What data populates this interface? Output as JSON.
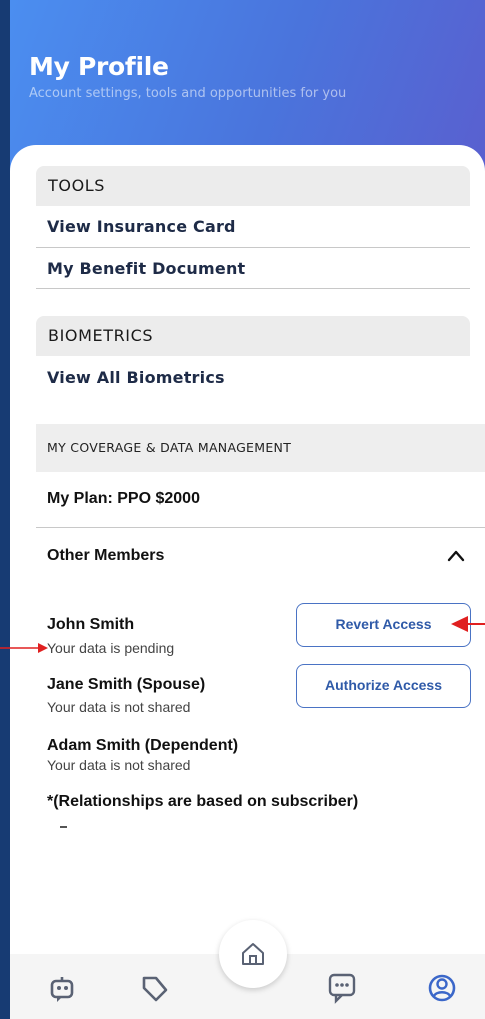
{
  "header": {
    "title": "My Profile",
    "subtitle": "Account settings, tools and opportunities for you"
  },
  "tools": {
    "heading": "TOOLS",
    "items": [
      {
        "label": "View Insurance Card"
      },
      {
        "label": "My Benefit Document"
      }
    ]
  },
  "biometrics": {
    "heading": "BIOMETRICS",
    "items": [
      {
        "label": "View All Biometrics"
      }
    ]
  },
  "coverage": {
    "heading": "MY COVERAGE & DATA MANAGEMENT",
    "plan_label": "My Plan: PPO $2000",
    "other_members_label": "Other Members",
    "members": [
      {
        "name": "John Smith",
        "status": "Your data is pending",
        "action": "Revert Access"
      },
      {
        "name": "Jane Smith (Spouse)",
        "status": "Your data is not shared",
        "action": "Authorize Access"
      },
      {
        "name": "Adam Smith (Dependent)",
        "status": "Your data is not shared",
        "action": ""
      }
    ],
    "note": "*(Relationships are based on subscriber)"
  },
  "tabbar": {
    "tabs": [
      {
        "icon": "chat-bot-icon"
      },
      {
        "icon": "heart-tag-icon"
      },
      {
        "icon": "home-icon"
      },
      {
        "icon": "message-dots-icon"
      },
      {
        "icon": "profile-icon"
      }
    ],
    "active_color": "#3b67c9",
    "icon_color": "#5a6274"
  },
  "colors": {
    "header_start": "#4b8ef0",
    "header_end": "#5a5fcf",
    "annotation_arrow": "#e02020"
  }
}
